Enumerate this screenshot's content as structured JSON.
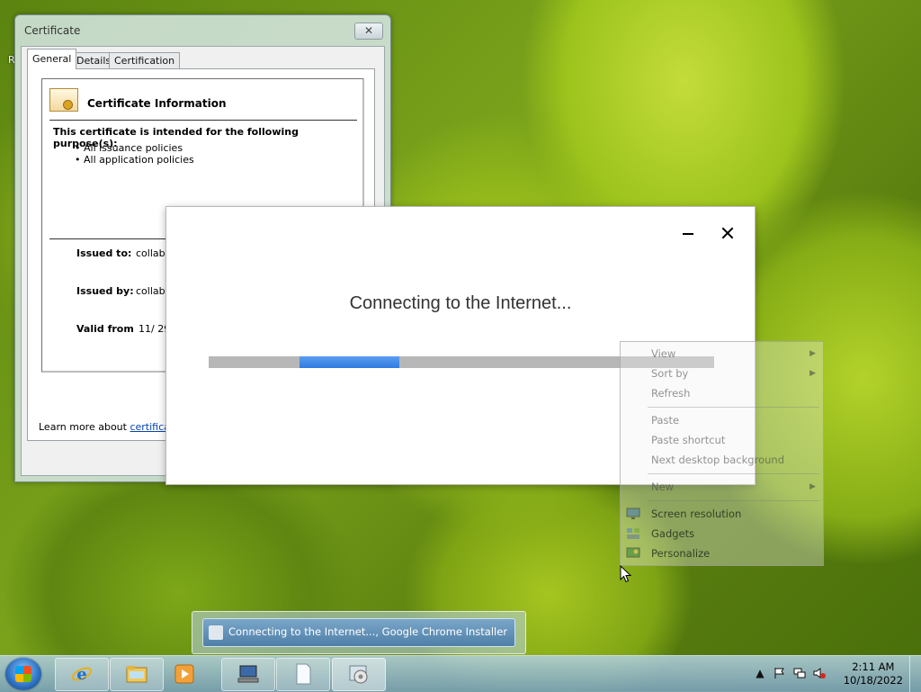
{
  "desktop": {
    "edge_text": "R"
  },
  "certificate_window": {
    "title": "Certificate",
    "close_glyph": "✕",
    "tabs": [
      "General",
      "Details",
      "Certification Path"
    ],
    "heading": "Certificate Information",
    "purpose_text": "This certificate is intended for the following purpose(s):",
    "purposes": [
      "• All issuance policies",
      "• All application policies"
    ],
    "issued_to_label": "Issued to:",
    "issued_to_value": "collabn",
    "issued_by_label": "Issued by:",
    "issued_by_value": "collabn",
    "valid_from_label": "Valid from",
    "valid_from_value": "11/ 29",
    "learn_more_prefix": "Learn more about ",
    "learn_more_link": "certificates"
  },
  "installer": {
    "status_text": "Connecting to the Internet...",
    "progress_indicator": "indeterminate"
  },
  "context_menu": {
    "items": [
      {
        "label": "View",
        "submenu": true,
        "enabled": false
      },
      {
        "label": "Sort by",
        "submenu": true,
        "enabled": false
      },
      {
        "label": "Refresh",
        "submenu": false,
        "enabled": false
      },
      {
        "label": "Paste",
        "submenu": false,
        "enabled": false
      },
      {
        "label": "Paste shortcut",
        "submenu": false,
        "enabled": false
      },
      {
        "label": "Next desktop background",
        "submenu": false,
        "enabled": false
      },
      {
        "label": "New",
        "submenu": true,
        "enabled": false
      },
      {
        "label": "Screen resolution",
        "submenu": false,
        "enabled": true
      },
      {
        "label": "Gadgets",
        "submenu": false,
        "enabled": true
      },
      {
        "label": "Personalize",
        "submenu": false,
        "enabled": true
      }
    ]
  },
  "taskbar_thumbnail": {
    "label": "Connecting to the Internet..., Google Chrome Installer"
  },
  "taskbar": {
    "pinned": [
      "internet-explorer-icon",
      "windows-explorer-icon",
      "media-player-icon",
      "network-computer-icon",
      "document-icon",
      "chrome-installer-icon"
    ],
    "clock_time": "2:11 AM",
    "clock_date": "10/18/2022"
  },
  "colors": {
    "progress": "#2f7be0",
    "link": "#0645ad"
  }
}
